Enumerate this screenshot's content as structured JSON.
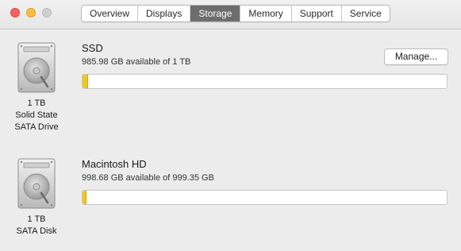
{
  "window": {
    "tabs": [
      "Overview",
      "Displays",
      "Storage",
      "Memory",
      "Support",
      "Service"
    ],
    "active_tab": "Storage"
  },
  "drives": [
    {
      "name": "SSD",
      "available_text": "985.98 GB available of 1 TB",
      "caption_lines": [
        "1 TB",
        "Solid State",
        "SATA Drive"
      ],
      "used_fraction": 0.014,
      "manage_label": "Manage...",
      "icon": "hard-drive-icon"
    },
    {
      "name": "Macintosh HD",
      "available_text": "998.68 GB available of 999.35 GB",
      "caption_lines": [
        "1 TB",
        "SATA Disk"
      ],
      "used_fraction": 0.0007,
      "icon": "hard-drive-icon"
    }
  ],
  "colors": {
    "active_tab": "#6d6d6d",
    "usage_fill": "#f5c518",
    "close": "#fc605c",
    "minimize": "#fdbc40"
  }
}
